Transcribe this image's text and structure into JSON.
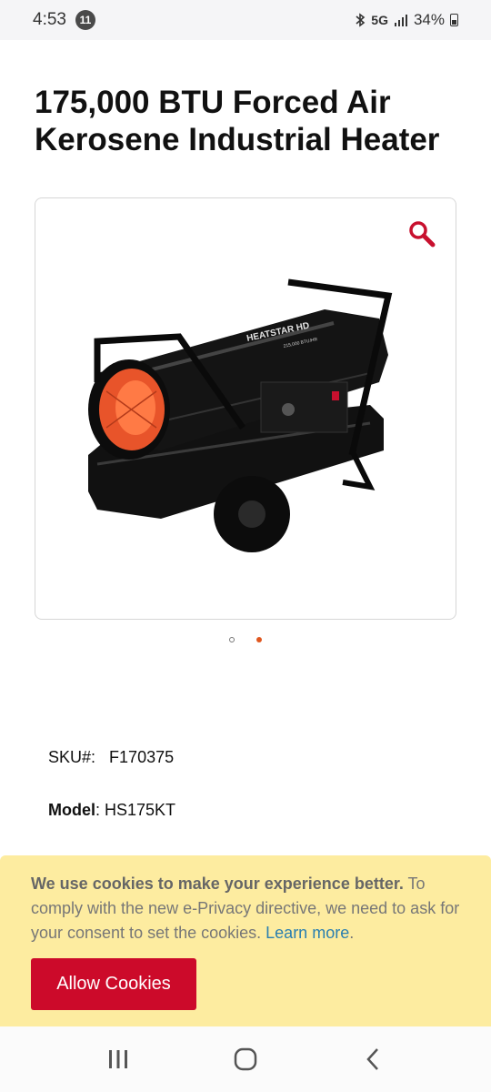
{
  "status_bar": {
    "time": "4:53",
    "notification_count": "11",
    "network": "5G",
    "battery": "34%"
  },
  "product": {
    "title": "175,000 BTU Forced Air Kerosene Industrial Heater",
    "sku_label": "SKU#:",
    "sku_value": "F170375",
    "model_label": "Model",
    "model_value": ": HS175KT",
    "image_brand_text": "HEATSTAR HD",
    "image_rating_text": "215,000 BTU/HR"
  },
  "carousel": {
    "slide_count": 2,
    "active_index": 1,
    "active_color": "#e0571f"
  },
  "cookie_banner": {
    "bold_text": "We use cookies to make your experience better.",
    "body_text": " To comply with the new e-Privacy directive, we need to ask for your consent to set the cookies. ",
    "link_text": "Learn more",
    "period": ".",
    "button_label": "Allow Cookies",
    "background": "#fdeca0",
    "button_color": "#cc0a2a"
  },
  "nav_bar": {
    "recent_icon": "recent-apps-icon",
    "home_icon": "home-icon",
    "back_icon": "back-icon"
  }
}
